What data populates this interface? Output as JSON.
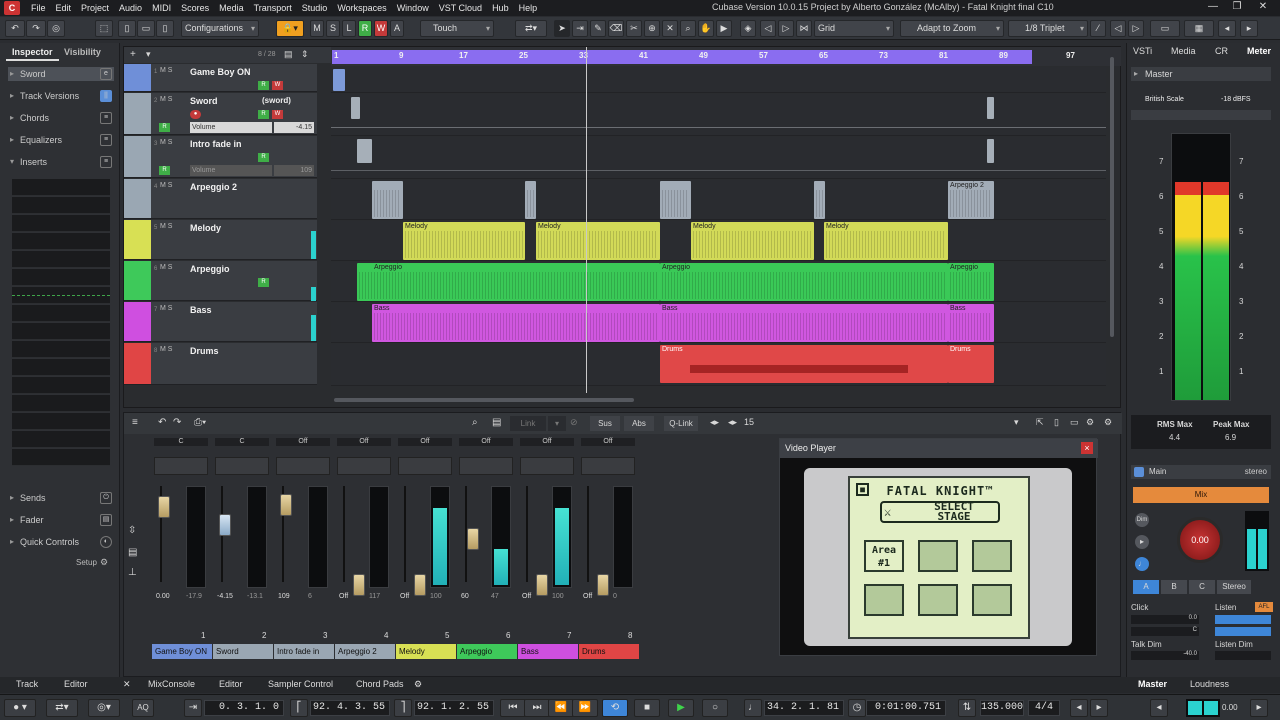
{
  "menubar": {
    "items": [
      "File",
      "Edit",
      "Project",
      "Audio",
      "MIDI",
      "Scores",
      "Media",
      "Transport",
      "Studio",
      "Workspaces",
      "Window",
      "VST Cloud",
      "Hub",
      "Help"
    ],
    "window_title": "Cubase Version 10.0.15 Project by Alberto González (McAlby) - Fatal Knight final C10",
    "win_min": "—",
    "win_max": "❐",
    "win_close": "✕"
  },
  "toolbar": {
    "configurations": "Configurations",
    "m": "M",
    "s": "S",
    "l": "L",
    "r": "R",
    "w": "W",
    "a": "A",
    "automation_mode": "Touch",
    "snap_type": "Grid",
    "zoom_mode": "Adapt to Zoom",
    "quantize": "1/8 Triplet"
  },
  "inspector": {
    "tab_inspector": "Inspector",
    "tab_visibility": "Visibility",
    "track_name": "Sword",
    "sections": [
      "Track Versions",
      "Chords",
      "Equalizers",
      "Inserts"
    ],
    "bottom_sections": [
      "Sends",
      "Fader",
      "Quick Controls"
    ],
    "setup": "Setup"
  },
  "project": {
    "track_count": "8 / 28",
    "ruler_marks": [
      "1",
      "9",
      "17",
      "25",
      "33",
      "41",
      "49",
      "57",
      "65",
      "73",
      "81",
      "89",
      "97"
    ],
    "tracks": [
      {
        "num": "1",
        "name": "Game Boy ON",
        "color": "#6f8fd8"
      },
      {
        "num": "2",
        "name": "Sword",
        "extra": "(sword)",
        "color": "#9aa7b3",
        "vol_label": "Volume",
        "vol_value": "-4.15"
      },
      {
        "num": "3",
        "name": "Intro fade in",
        "color": "#9aa7b3",
        "vol_label": "Volume",
        "vol_value": "109"
      },
      {
        "num": "4",
        "name": "Arpeggio 2",
        "color": "#9aa7b3"
      },
      {
        "num": "5",
        "name": "Melody",
        "color": "#d8e054"
      },
      {
        "num": "6",
        "name": "Arpeggio",
        "color": "#3ec95a"
      },
      {
        "num": "7",
        "name": "Bass",
        "color": "#cf4fe0"
      },
      {
        "num": "8",
        "name": "Drums",
        "color": "#e04545"
      }
    ],
    "clips": {
      "melody": "Melody",
      "arpeggio": "Arpeggio",
      "arpeggio2": "Arpeggio 2",
      "bass": "Bass",
      "drums": "Drums"
    }
  },
  "mixer": {
    "link": "Link",
    "sus": "Sus",
    "abs": "Abs",
    "qlink": "Q-Link",
    "channels_shown": "15",
    "top_labels": [
      "C",
      "C",
      "Off",
      "Off",
      "Off",
      "Off",
      "Off",
      "Off"
    ],
    "values_top": [
      "0.00",
      "-4.15",
      "109",
      "Off",
      "Off",
      "60",
      "Off",
      "Off"
    ],
    "values_top2": [
      "-17.9",
      "-13.1",
      "6",
      "117",
      "100",
      "47",
      "100",
      "0"
    ],
    "numbers": [
      "1",
      "2",
      "3",
      "4",
      "5",
      "6",
      "7",
      "8"
    ],
    "names": [
      "Game Boy ON",
      "Sword",
      "Intro fade in",
      "Arpeggio 2",
      "Melody",
      "Arpeggio",
      "Bass",
      "Drums"
    ],
    "name_colors": [
      "#6f8fd8",
      "#9aa7b3",
      "#9aa7b3",
      "#9aa7b3",
      "#d8e054",
      "#3ec95a",
      "#cf4fe0",
      "#e04545"
    ]
  },
  "video": {
    "title": "Video Player",
    "game_title": "FATAL KNIGHT™",
    "select": "SELECT",
    "stage": "STAGE",
    "area_label": "Area",
    "area_num": "#1"
  },
  "rack": {
    "tabs": [
      "VSTi",
      "Media",
      "CR",
      "Meter"
    ],
    "master": "Master",
    "scale_label": "British Scale",
    "scale_value": "-18 dBFS",
    "scale_marks": [
      "7",
      "6",
      "5",
      "4",
      "3",
      "2",
      "1"
    ],
    "rms_label": "RMS Max",
    "rms_value": "4.4",
    "peak_label": "Peak Max",
    "peak_value": "6.9",
    "main": "Main",
    "stereo": "stereo",
    "mix": "Mix",
    "knob_value": "0.00",
    "abc": [
      "A",
      "B",
      "C",
      "Stereo"
    ],
    "click": "Click",
    "listen": "Listen",
    "click_val1": "0.0",
    "click_val2": "C",
    "talk_dim": "Talk Dim",
    "listen_dim": "Listen Dim",
    "talk_val": "-40.0",
    "listen_tag": "AFL"
  },
  "bottom_tabs": {
    "track": "Track",
    "editor": "Editor",
    "mixconsole": "MixConsole",
    "editor2": "Editor",
    "sampler": "Sampler Control",
    "chordpads": "Chord Pads",
    "master": "Master",
    "loudness": "Loudness"
  },
  "transport": {
    "punch_in": "0. 3. 1. 0",
    "left_locator": "92. 4. 3. 55",
    "right_locator": "92. 1. 2. 55",
    "position": "34. 2. 1. 81",
    "time": "0:01:00.751",
    "tempo": "135.000",
    "signature": "4/4",
    "level": "0.00",
    "aq": "AQ"
  }
}
